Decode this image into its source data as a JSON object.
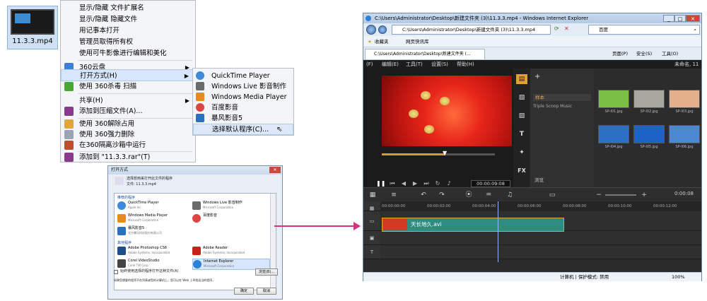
{
  "file": {
    "name": "11.3.3.mp4"
  },
  "context_menu": {
    "items": [
      {
        "label": "显示/隐藏 文件扩展名"
      },
      {
        "label": "显示/隐藏 隐藏文件"
      },
      {
        "label": "用记事本打开"
      },
      {
        "label": "管理员取得所有权"
      },
      {
        "label": "使用可牛影像进行编辑和美化"
      },
      {
        "label": "360云盘"
      },
      {
        "label": "打开方式(H)"
      },
      {
        "label": "使用 360杀毒 扫描"
      },
      {
        "label": "共享(H)"
      },
      {
        "label": "添加到压缩文件(A)..."
      },
      {
        "label": "使用 360解除占用"
      },
      {
        "label": "使用 360强力删除"
      },
      {
        "label": "在360隔离沙箱中运行"
      },
      {
        "label": "添加到 \"11.3.3.rar\"(T)"
      }
    ]
  },
  "submenu": {
    "items": [
      {
        "label": "QuickTime Player"
      },
      {
        "label": "Windows Live 影音制作"
      },
      {
        "label": "Windows Media Player"
      },
      {
        "label": "百度影音"
      },
      {
        "label": "暴风影音5"
      },
      {
        "label": "选择默认程序(C)..."
      }
    ]
  },
  "dialog": {
    "title": "打开方式",
    "prompt": "选择想用来打开此文件的程序",
    "file_line": "文件: 11.3.3.mp4",
    "group_recommended": "推荐的程序",
    "group_other": "其他程序",
    "programs": [
      {
        "name": "QuickTime Player",
        "publisher": "Apple Inc."
      },
      {
        "name": "Windows Live 影音制作",
        "publisher": "Microsoft Corporation"
      },
      {
        "name": "Windows Media Player",
        "publisher": "Microsoft Corporation"
      },
      {
        "name": "百度影音",
        "publisher": ""
      },
      {
        "name": "暴风影音5",
        "publisher": "北京暴风科技股份有限公司"
      },
      {
        "name": "Adobe Photoshop CS6",
        "publisher": "Adobe Systems, Incorporated"
      },
      {
        "name": "Adobe Reader",
        "publisher": "Adobe Systems, Incorporated"
      },
      {
        "name": "Corel VideoStudio",
        "publisher": "Corel TW Corp."
      },
      {
        "name": "Internet Explorer",
        "publisher": "Microsoft Corporation"
      }
    ],
    "checkbox_label": "始终使用选择的程序打开这种文件(A)",
    "browse_label": "浏览(B)...",
    "footer_text": "如果您想要的程序不在列表或您的计算机上，您可以在 Web 上寻找适当的程序。",
    "ok_label": "确定",
    "cancel_label": "取消"
  },
  "ie": {
    "title": "C:\\Users\\Administrator\\Desktop\\新建文件夹 (3)\\11.3.3.mp4 - Windows Internet Explorer",
    "address": "C:\\Users\\Administrator\\Desktop\\新建文件夹 (3)\\11.3.3.mp4",
    "search_placeholder": "百度",
    "favorites_label": "收藏夹",
    "suggested_sites": "网页快讯库",
    "tab_label": "C:\\Users\\Administrator\\Desktop\\新建文件夹 (...",
    "toolbar_page": "页面(P)",
    "toolbar_safety": "安全(S)",
    "toolbar_tools": "工具(O)",
    "status_zone": "计算机 | 保护模式: 禁用",
    "zoom": "100%"
  },
  "app": {
    "menu": [
      "(F)",
      "编辑(E)",
      "工具(T)",
      "设置(S)",
      "帮助(H)"
    ],
    "untitled": "未命名, 11",
    "library_selected": "样本",
    "library_item": "Triple Scoop Music",
    "browse_label": "浏览",
    "fx_label": "FX",
    "timecode": "00:00:09:08",
    "tooltip": "暂停",
    "timeline_time": "0:00:08",
    "ruler": [
      "00:00:00:00",
      "00:00:02:00",
      "00:00:04:00",
      "00:00:06:00",
      "00:00:08:00",
      "00:00:10:00",
      "00:00:12:00"
    ],
    "clip_label": "天长地久.avi",
    "thumbs": [
      "SP-I01.jpg",
      "SP-I02.jpg",
      "SP-I03.jpg",
      "SP-I04.jpg",
      "SP-I05.jpg",
      "SP-I06.jpg"
    ],
    "sample_colors": [
      "#7cbf45",
      "#a8a8a0",
      "#e3b08b",
      "#2d6fc4",
      "#1d63c6",
      "#4b88d1"
    ]
  }
}
